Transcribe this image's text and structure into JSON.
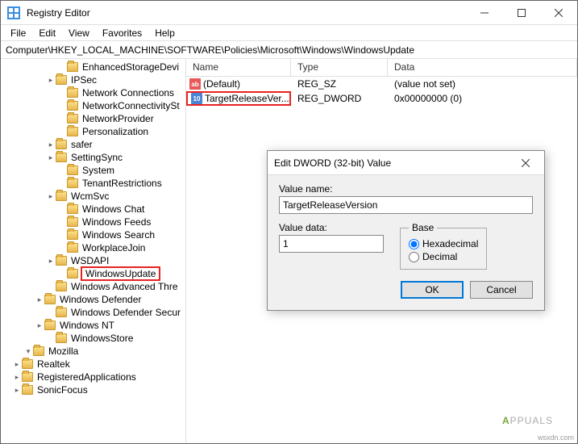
{
  "window": {
    "title": "Registry Editor"
  },
  "menu": [
    "File",
    "Edit",
    "View",
    "Favorites",
    "Help"
  ],
  "address_path": "Computer\\HKEY_LOCAL_MACHINE\\SOFTWARE\\Policies\\Microsoft\\Windows\\WindowsUpdate",
  "tree": [
    {
      "indent": 5,
      "expander": "",
      "label": "EnhancedStorageDevi"
    },
    {
      "indent": 4,
      "expander": ">",
      "label": "IPSec"
    },
    {
      "indent": 5,
      "expander": "",
      "label": "Network Connections"
    },
    {
      "indent": 5,
      "expander": "",
      "label": "NetworkConnectivitySt"
    },
    {
      "indent": 5,
      "expander": "",
      "label": "NetworkProvider"
    },
    {
      "indent": 5,
      "expander": "",
      "label": "Personalization"
    },
    {
      "indent": 4,
      "expander": ">",
      "label": "safer"
    },
    {
      "indent": 4,
      "expander": ">",
      "label": "SettingSync"
    },
    {
      "indent": 5,
      "expander": "",
      "label": "System"
    },
    {
      "indent": 5,
      "expander": "",
      "label": "TenantRestrictions"
    },
    {
      "indent": 4,
      "expander": ">",
      "label": "WcmSvc"
    },
    {
      "indent": 5,
      "expander": "",
      "label": "Windows Chat"
    },
    {
      "indent": 5,
      "expander": "",
      "label": "Windows Feeds"
    },
    {
      "indent": 5,
      "expander": "",
      "label": "Windows Search"
    },
    {
      "indent": 5,
      "expander": "",
      "label": "WorkplaceJoin"
    },
    {
      "indent": 4,
      "expander": ">",
      "label": "WSDAPI"
    },
    {
      "indent": 5,
      "expander": "",
      "label": "WindowsUpdate",
      "selected": true
    },
    {
      "indent": 4,
      "expander": "",
      "label": "Windows Advanced Thre"
    },
    {
      "indent": 3,
      "expander": ">",
      "label": "Windows Defender"
    },
    {
      "indent": 4,
      "expander": "",
      "label": "Windows Defender Secur"
    },
    {
      "indent": 3,
      "expander": ">",
      "label": "Windows NT"
    },
    {
      "indent": 4,
      "expander": "",
      "label": "WindowsStore"
    },
    {
      "indent": 2,
      "expander": "v",
      "label": "Mozilla"
    },
    {
      "indent": 1,
      "expander": ">",
      "label": "Realtek"
    },
    {
      "indent": 1,
      "expander": ">",
      "label": "RegisteredApplications"
    },
    {
      "indent": 1,
      "expander": ">",
      "label": "SonicFocus"
    }
  ],
  "list": {
    "headers": {
      "name": "Name",
      "type": "Type",
      "data": "Data"
    },
    "rows": [
      {
        "icon": "sz",
        "name": "(Default)",
        "type": "REG_SZ",
        "data": "(value not set)",
        "highlighted": false
      },
      {
        "icon": "dw",
        "name": "TargetReleaseVer...",
        "type": "REG_DWORD",
        "data": "0x00000000 (0)",
        "highlighted": true
      }
    ]
  },
  "dialog": {
    "title": "Edit DWORD (32-bit) Value",
    "valuename_label": "Value name:",
    "valuename": "TargetReleaseVersion",
    "valuedata_label": "Value data:",
    "valuedata": "1",
    "base_legend": "Base",
    "hex_label": "Hexadecimal",
    "dec_label": "Decimal",
    "ok": "OK",
    "cancel": "Cancel"
  },
  "watermark": {
    "a": "A",
    "ppuals": "PPUALS"
  },
  "corner": "wsxdn.com"
}
